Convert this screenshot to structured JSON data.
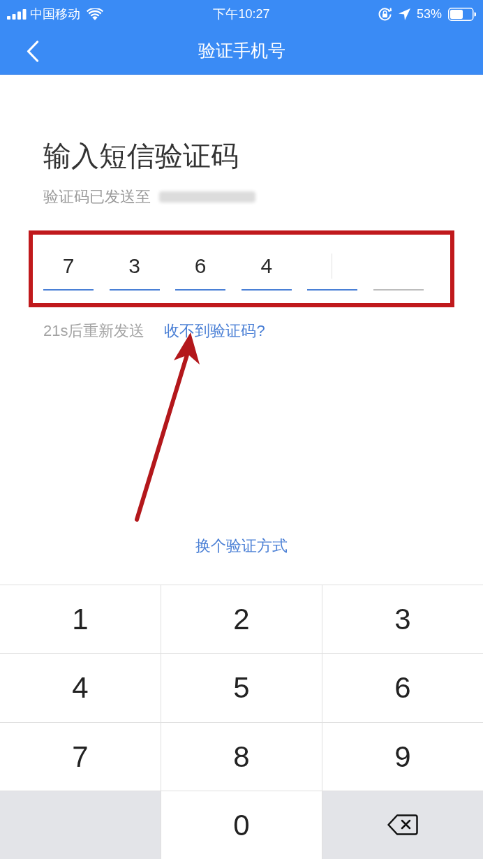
{
  "status_bar": {
    "carrier": "中国移动",
    "time": "下午10:27",
    "battery": "53%"
  },
  "header": {
    "title": "验证手机号"
  },
  "heading": "输入短信验证码",
  "subtitle": "验证码已发送至",
  "code_cells": [
    {
      "value": "7",
      "active": true,
      "focused": false
    },
    {
      "value": "3",
      "active": true,
      "focused": false
    },
    {
      "value": "6",
      "active": true,
      "focused": false
    },
    {
      "value": "4",
      "active": true,
      "focused": false
    },
    {
      "active": true,
      "focused": true
    },
    {
      "active": false,
      "focused": false
    }
  ],
  "resend": "21s后重新发送",
  "help_link": "收不到验证码?",
  "switch_method": "换个验证方式",
  "keypad": [
    {
      "kind": "digit",
      "label": "1"
    },
    {
      "kind": "digit",
      "label": "2"
    },
    {
      "kind": "digit",
      "label": "3"
    },
    {
      "kind": "digit",
      "label": "4"
    },
    {
      "kind": "digit",
      "label": "5"
    },
    {
      "kind": "digit",
      "label": "6"
    },
    {
      "kind": "digit",
      "label": "7"
    },
    {
      "kind": "digit",
      "label": "8"
    },
    {
      "kind": "digit",
      "label": "9"
    },
    {
      "kind": "blank"
    },
    {
      "kind": "digit",
      "label": "0"
    },
    {
      "kind": "delete"
    }
  ]
}
